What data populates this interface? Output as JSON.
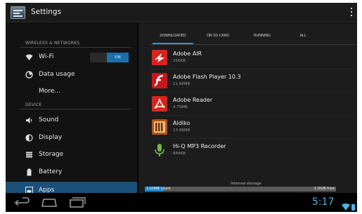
{
  "actionbar": {
    "title": "Settings",
    "app_icon": "settings-app-icon",
    "overflow_icon": "overflow-menu-icon"
  },
  "sidebar": {
    "section_wireless": "WIRELESS & NETWORKS",
    "section_device": "DEVICE",
    "items": [
      {
        "label": "Wi-Fi",
        "icon": "wifi-icon",
        "toggle": "ON"
      },
      {
        "label": "Data usage",
        "icon": "data-usage-icon"
      },
      {
        "label": "More..."
      },
      {
        "label": "Sound",
        "icon": "speaker-icon"
      },
      {
        "label": "Display",
        "icon": "display-icon"
      },
      {
        "label": "Storage",
        "icon": "storage-icon"
      },
      {
        "label": "Battery",
        "icon": "battery-icon"
      },
      {
        "label": "Apps",
        "icon": "apps-icon",
        "selected": true
      }
    ]
  },
  "tabs": [
    {
      "label": "DOWNLOADED",
      "selected": true
    },
    {
      "label": "ON SD CARD"
    },
    {
      "label": "RUNNING"
    },
    {
      "label": "ALL"
    }
  ],
  "apps": [
    {
      "name": "Adobe AIR",
      "size": "256KB",
      "icon": "adobe-air-icon",
      "color": "#d9231f"
    },
    {
      "name": "Adobe Flash Player 10.3",
      "size": "11.98MB",
      "icon": "adobe-flash-icon",
      "color": "#c8161d"
    },
    {
      "name": "Adobe Reader",
      "size": "4.79MB",
      "icon": "adobe-reader-icon",
      "color": "#d4281f"
    },
    {
      "name": "Aldiko",
      "size": "13.98MB",
      "icon": "aldiko-icon",
      "color": "#b3541e"
    },
    {
      "name": "Hi-Q MP3 Recorder",
      "size": "884KB",
      "icon": "microphone-icon",
      "color": "#7ab648"
    }
  ],
  "storage": {
    "label": "Internal storage",
    "used": "110MB used",
    "free": "1.0GB free",
    "used_fraction": 0.1
  },
  "systembar": {
    "time": "5:17",
    "back_icon": "back-icon",
    "home_icon": "home-icon",
    "recent_icon": "recent-apps-icon"
  }
}
